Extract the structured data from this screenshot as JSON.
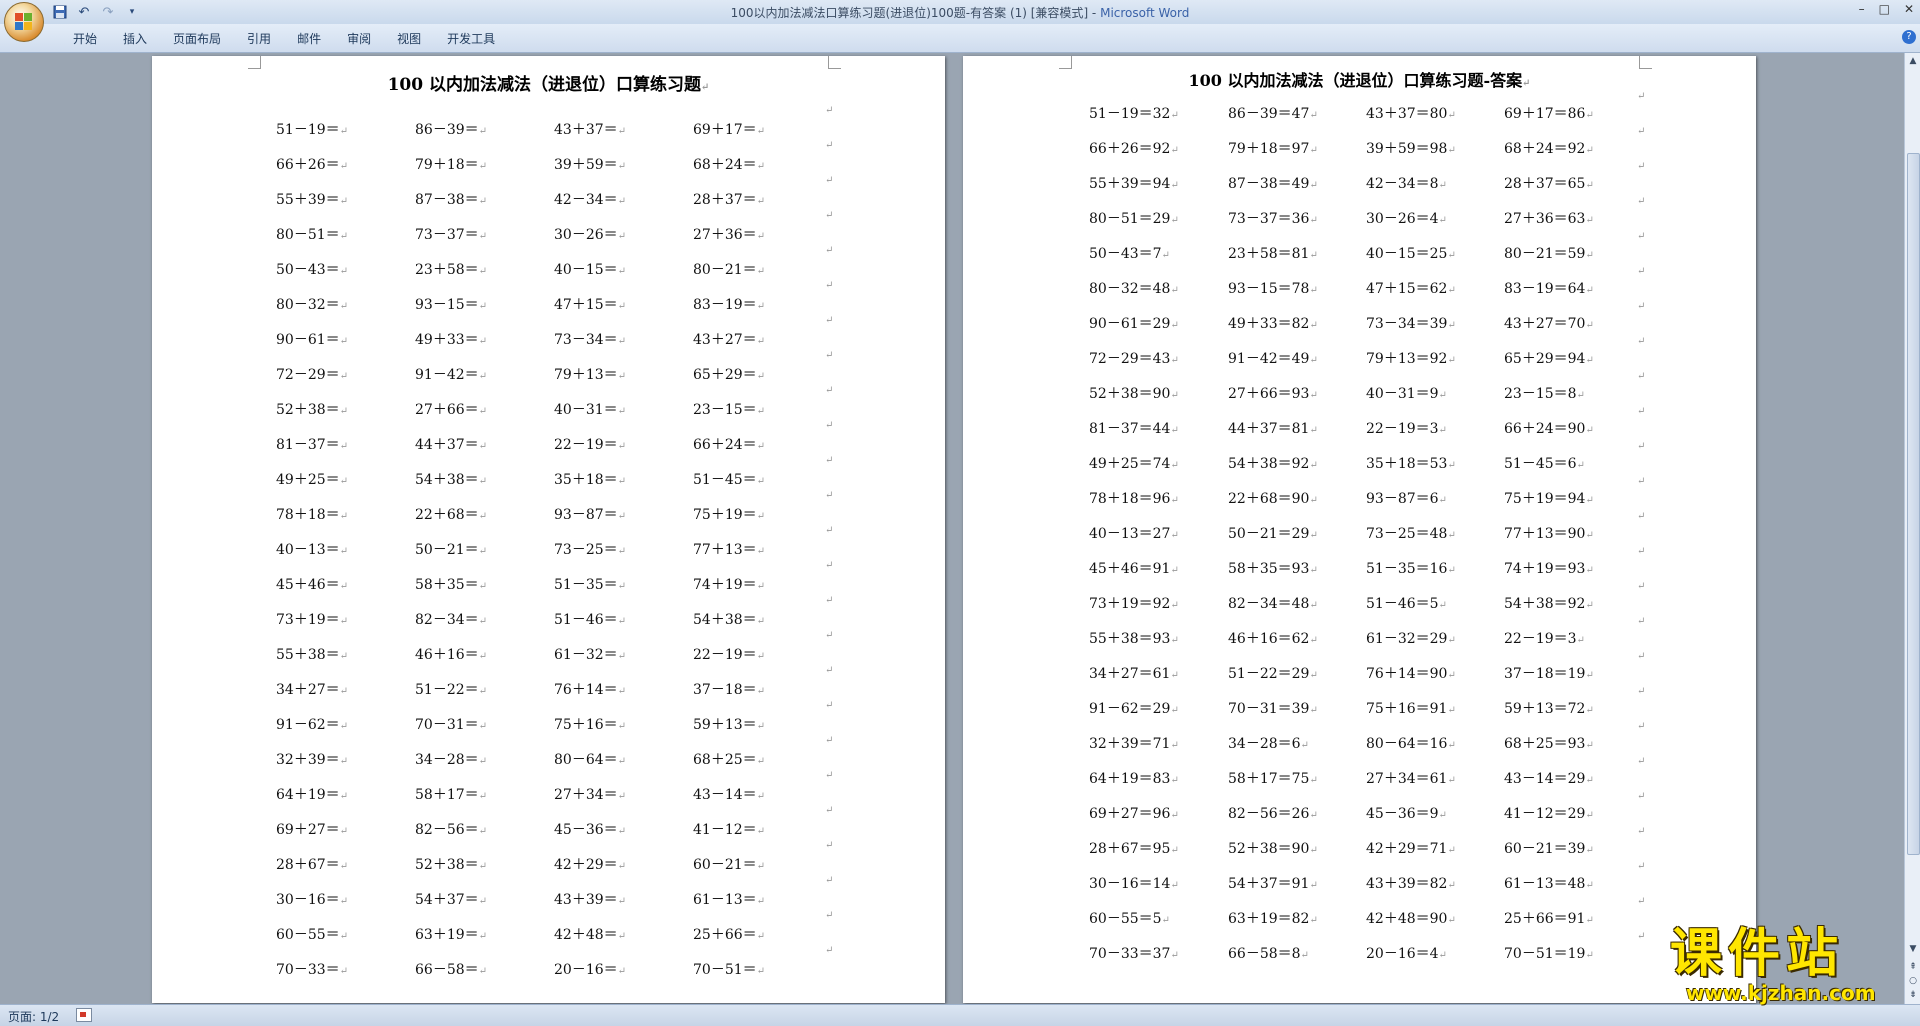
{
  "window": {
    "title": "100以内加法减法口算练习题(进退位)100题-有答案 (1) [兼容模式] - ",
    "app_name": "Microsoft Word",
    "controls": [
      "–",
      "□",
      "✕"
    ]
  },
  "ribbon": {
    "tabs": [
      "开始",
      "插入",
      "页面布局",
      "引用",
      "邮件",
      "审阅",
      "视图",
      "开发工具"
    ],
    "help": "?"
  },
  "page1": {
    "title": "100 以内加法减法（进退位）口算练习题",
    "mark": "↵",
    "rows": [
      [
        "51－19＝",
        "86－39＝",
        "43＋37＝",
        "69＋17＝"
      ],
      [
        "66＋26＝",
        "79＋18＝",
        "39＋59＝",
        "68＋24＝"
      ],
      [
        "55＋39＝",
        "87－38＝",
        "42－34＝",
        "28＋37＝"
      ],
      [
        "80－51＝",
        "73－37＝",
        "30－26＝",
        "27＋36＝"
      ],
      [
        "50－43＝",
        "23＋58＝",
        "40－15＝",
        "80－21＝"
      ],
      [
        "80－32＝",
        "93－15＝",
        "47＋15＝",
        "83－19＝"
      ],
      [
        "90－61＝",
        "49＋33＝",
        "73－34＝",
        "43＋27＝"
      ],
      [
        "72－29＝",
        "91－42＝",
        "79＋13＝",
        "65＋29＝"
      ],
      [
        "52＋38＝",
        "27＋66＝",
        "40－31＝",
        "23－15＝"
      ],
      [
        "81－37＝",
        "44＋37＝",
        "22－19＝",
        "66＋24＝"
      ],
      [
        "49＋25＝",
        "54＋38＝",
        "35＋18＝",
        "51－45＝"
      ],
      [
        "78＋18＝",
        "22＋68＝",
        "93－87＝",
        "75＋19＝"
      ],
      [
        "40－13＝",
        "50－21＝",
        "73－25＝",
        "77＋13＝"
      ],
      [
        "45＋46＝",
        "58＋35＝",
        "51－35＝",
        "74＋19＝"
      ],
      [
        "73＋19＝",
        "82－34＝",
        "51－46＝",
        "54＋38＝"
      ],
      [
        "55＋38＝",
        "46＋16＝",
        "61－32＝",
        "22－19＝"
      ],
      [
        "34＋27＝",
        "51－22＝",
        "76＋14＝",
        "37－18＝"
      ],
      [
        "91－62＝",
        "70－31＝",
        "75＋16＝",
        "59＋13＝"
      ],
      [
        "32＋39＝",
        "34－28＝",
        "80－64＝",
        "68＋25＝"
      ],
      [
        "64＋19＝",
        "58＋17＝",
        "27＋34＝",
        "43－14＝"
      ],
      [
        "69＋27＝",
        "82－56＝",
        "45－36＝",
        "41－12＝"
      ],
      [
        "28＋67＝",
        "52＋38＝",
        "42＋29＝",
        "60－21＝"
      ],
      [
        "30－16＝",
        "54＋37＝",
        "43＋39＝",
        "61－13＝"
      ],
      [
        "60－55＝",
        "63＋19＝",
        "42＋48＝",
        "25＋66＝"
      ],
      [
        "70－33＝",
        "66－58＝",
        "20－16＝",
        "70－51＝"
      ]
    ]
  },
  "page2": {
    "title": "100 以内加法减法（进退位）口算练习题-答案",
    "mark": "↵",
    "rows": [
      [
        "51－19＝32",
        "86－39＝47",
        "43＋37＝80",
        "69＋17＝86"
      ],
      [
        "66＋26＝92",
        "79＋18＝97",
        "39＋59＝98",
        "68＋24＝92"
      ],
      [
        "55＋39＝94",
        "87－38＝49",
        "42－34＝8",
        "28＋37＝65"
      ],
      [
        "80－51＝29",
        "73－37＝36",
        "30－26＝4",
        "27＋36＝63"
      ],
      [
        "50－43＝7",
        "23＋58＝81",
        "40－15＝25",
        "80－21＝59"
      ],
      [
        "80－32＝48",
        "93－15＝78",
        "47＋15＝62",
        "83－19＝64"
      ],
      [
        "90－61＝29",
        "49＋33＝82",
        "73－34＝39",
        "43＋27＝70"
      ],
      [
        "72－29＝43",
        "91－42＝49",
        "79＋13＝92",
        "65＋29＝94"
      ],
      [
        "52＋38＝90",
        "27＋66＝93",
        "40－31＝9",
        "23－15＝8"
      ],
      [
        "81－37＝44",
        "44＋37＝81",
        "22－19＝3",
        "66＋24＝90"
      ],
      [
        "49＋25＝74",
        "54＋38＝92",
        "35＋18＝53",
        "51－45＝6"
      ],
      [
        "78＋18＝96",
        "22＋68＝90",
        "93－87＝6",
        "75＋19＝94"
      ],
      [
        "40－13＝27",
        "50－21＝29",
        "73－25＝48",
        "77＋13＝90"
      ],
      [
        "45＋46＝91",
        "58＋35＝93",
        "51－35＝16",
        "74＋19＝93"
      ],
      [
        "73＋19＝92",
        "82－34＝48",
        "51－46＝5",
        "54＋38＝92"
      ],
      [
        "55＋38＝93",
        "46＋16＝62",
        "61－32＝29",
        "22－19＝3"
      ],
      [
        "34＋27＝61",
        "51－22＝29",
        "76＋14＝90",
        "37－18＝19"
      ],
      [
        "91－62＝29",
        "70－31＝39",
        "75＋16＝91",
        "59＋13＝72"
      ],
      [
        "32＋39＝71",
        "34－28＝6",
        "80－64＝16",
        "68＋25＝93"
      ],
      [
        "64＋19＝83",
        "58＋17＝75",
        "27＋34＝61",
        "43－14＝29"
      ],
      [
        "69＋27＝96",
        "82－56＝26",
        "45－36＝9",
        "41－12＝29"
      ],
      [
        "28＋67＝95",
        "52＋38＝90",
        "42＋29＝71",
        "60－21＝39"
      ],
      [
        "30－16＝14",
        "54＋37＝91",
        "43＋39＝82",
        "61－13＝48"
      ],
      [
        "60－55＝5",
        "63＋19＝82",
        "42＋48＝90",
        "25＋66＝91"
      ],
      [
        "70－33＝37",
        "66－58＝8",
        "20－16＝4",
        "70－51＝19"
      ]
    ]
  },
  "status": {
    "page_indicator": "页面: 1/2"
  },
  "watermark": {
    "text": "课件站",
    "url": "www.kjzhan.com"
  }
}
